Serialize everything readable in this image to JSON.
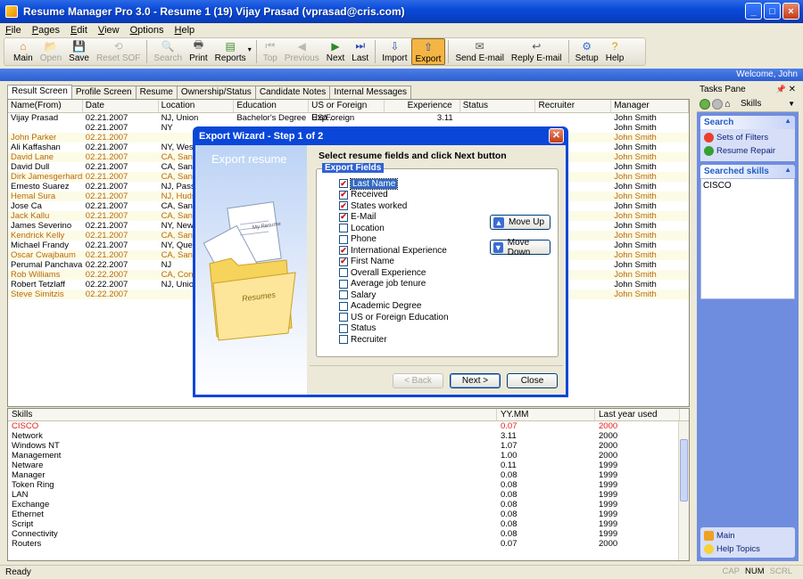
{
  "window": {
    "title": "Resume Manager Pro 3.0 - Resume 1 (19)   Vijay Prasad (vprasad@cris.com)",
    "controls": [
      "_",
      "□",
      "×"
    ]
  },
  "menu": [
    "File",
    "Pages",
    "Edit",
    "View",
    "Options",
    "Help"
  ],
  "toolbar": [
    {
      "label": "Main",
      "icon": "main-icon",
      "state": "normal"
    },
    {
      "label": "Open",
      "icon": "open-icon",
      "state": "disabled"
    },
    {
      "label": "Save",
      "icon": "save-icon",
      "state": "normal"
    },
    {
      "label": "Reset SOF",
      "icon": "reset-icon",
      "state": "disabled"
    },
    {
      "label": "Search",
      "icon": "search-icon",
      "state": "disabled"
    },
    {
      "label": "Print",
      "icon": "print-icon",
      "state": "normal"
    },
    {
      "label": "Reports",
      "icon": "reports-icon",
      "state": "normal"
    },
    {
      "label": "Top",
      "icon": "top-icon",
      "state": "disabled"
    },
    {
      "label": "Previous",
      "icon": "previous-icon",
      "state": "disabled"
    },
    {
      "label": "Next",
      "icon": "next-icon",
      "state": "normal"
    },
    {
      "label": "Last",
      "icon": "last-icon",
      "state": "normal"
    },
    {
      "label": "Import",
      "icon": "import-icon",
      "state": "normal"
    },
    {
      "label": "Export",
      "icon": "export-icon",
      "state": "active"
    },
    {
      "label": "Send E-mail",
      "icon": "send-email-icon",
      "state": "normal"
    },
    {
      "label": "Reply E-mail",
      "icon": "reply-email-icon",
      "state": "normal"
    },
    {
      "label": "Setup",
      "icon": "setup-icon",
      "state": "normal"
    },
    {
      "label": "Help",
      "icon": "help-icon",
      "state": "normal"
    }
  ],
  "welcome": "Welcome, John",
  "tabs": [
    "Result Screen",
    "Profile Screen",
    "Resume",
    "Ownership/Status",
    "Candidate Notes",
    "Internal Messages"
  ],
  "results": {
    "columns": [
      "Name(From)",
      "Date",
      "Location",
      "Education",
      "US or Foreign Exp...",
      "Experience",
      "Status",
      "Recruiter",
      "Manager"
    ],
    "rows": [
      {
        "name": "Vijay Prasad",
        "date": "02.21.2007",
        "location": "NJ, Union",
        "education": "Bachelor's Degree",
        "usf": "US/Foreign",
        "experience": "3.11",
        "manager": "John Smith",
        "orange": false
      },
      {
        "name": "",
        "date": "02.21.2007",
        "location": "NY",
        "education": "",
        "usf": "",
        "experience": "",
        "manager": "John Smith",
        "orange": false
      },
      {
        "name": "John Parker",
        "date": "02.21.2007",
        "location": "",
        "education": "",
        "usf": "",
        "experience": "",
        "manager": "John Smith",
        "orange": true
      },
      {
        "name": "Ali Kaffashan",
        "date": "02.21.2007",
        "location": "NY, West",
        "education": "",
        "usf": "",
        "experience": "",
        "manager": "John Smith",
        "orange": false
      },
      {
        "name": "David Lane",
        "date": "02.21.2007",
        "location": "CA, Sant",
        "education": "",
        "usf": "",
        "experience": "",
        "manager": "John Smith",
        "orange": true
      },
      {
        "name": "David Dull",
        "date": "02.21.2007",
        "location": "CA, San",
        "education": "",
        "usf": "",
        "experience": "",
        "manager": "John Smith",
        "orange": false
      },
      {
        "name": "Dirk Jamesgerhardr...",
        "date": "02.21.2007",
        "location": "CA, Sant",
        "education": "",
        "usf": "",
        "experience": "",
        "manager": "John Smith",
        "orange": true
      },
      {
        "name": "Ernesto Suarez",
        "date": "02.21.2007",
        "location": "NJ, Pass",
        "education": "",
        "usf": "",
        "experience": "",
        "manager": "John Smith",
        "orange": false
      },
      {
        "name": "Hemal Sura",
        "date": "02.21.2007",
        "location": "NJ, Huds",
        "education": "",
        "usf": "",
        "experience": "",
        "manager": "John Smith",
        "orange": true
      },
      {
        "name": "Jose Ca",
        "date": "02.21.2007",
        "location": "CA, Sant",
        "education": "",
        "usf": "",
        "experience": "",
        "manager": "John Smith",
        "orange": false
      },
      {
        "name": "Jack Kallu",
        "date": "02.21.2007",
        "location": "CA, Sant",
        "education": "",
        "usf": "",
        "experience": "",
        "manager": "John Smith",
        "orange": true
      },
      {
        "name": "James Severino",
        "date": "02.21.2007",
        "location": "NY, New",
        "education": "",
        "usf": "",
        "experience": "",
        "manager": "John Smith",
        "orange": false
      },
      {
        "name": "Kendrick Kelly",
        "date": "02.21.2007",
        "location": "CA, San",
        "education": "",
        "usf": "",
        "experience": "",
        "manager": "John Smith",
        "orange": true
      },
      {
        "name": "Michael Frandy",
        "date": "02.21.2007",
        "location": "NY, Quee",
        "education": "",
        "usf": "",
        "experience": "",
        "manager": "John Smith",
        "orange": false
      },
      {
        "name": "Oscar Cwajbaum",
        "date": "02.21.2007",
        "location": "CA, Sant",
        "education": "",
        "usf": "",
        "experience": "",
        "manager": "John Smith",
        "orange": true
      },
      {
        "name": "Perumal Panchava...",
        "date": "02.22.2007",
        "location": "NJ",
        "education": "",
        "usf": "",
        "experience": "",
        "manager": "John Smith",
        "orange": false
      },
      {
        "name": "Rob Williams",
        "date": "02.22.2007",
        "location": "CA, Cont",
        "education": "",
        "usf": "",
        "experience": "",
        "manager": "John Smith",
        "orange": true
      },
      {
        "name": "Robert Tetzlaff",
        "date": "02.22.2007",
        "location": "NJ, Unio",
        "education": "",
        "usf": "",
        "experience": "",
        "manager": "John Smith",
        "orange": false
      },
      {
        "name": "Steve Simitzis",
        "date": "02.22.2007",
        "location": "",
        "education": "",
        "usf": "",
        "experience": "",
        "manager": "John Smith",
        "orange": true
      }
    ]
  },
  "skills": {
    "columns": [
      "Skills",
      "YY.MM",
      "Last year used"
    ],
    "rows": [
      {
        "skill": "CISCO",
        "yymm": "0.07",
        "last": "2000",
        "highlight": true
      },
      {
        "skill": "Network",
        "yymm": "3.11",
        "last": "2000",
        "highlight": false
      },
      {
        "skill": "Windows NT",
        "yymm": "1.07",
        "last": "2000",
        "highlight": false
      },
      {
        "skill": "Management",
        "yymm": "1.00",
        "last": "2000",
        "highlight": false
      },
      {
        "skill": "Netware",
        "yymm": "0.11",
        "last": "1999",
        "highlight": false
      },
      {
        "skill": "Manager",
        "yymm": "0.08",
        "last": "1999",
        "highlight": false
      },
      {
        "skill": "Token Ring",
        "yymm": "0.08",
        "last": "1999",
        "highlight": false
      },
      {
        "skill": "LAN",
        "yymm": "0.08",
        "last": "1999",
        "highlight": false
      },
      {
        "skill": "Exchange",
        "yymm": "0.08",
        "last": "1999",
        "highlight": false
      },
      {
        "skill": "Ethernet",
        "yymm": "0.08",
        "last": "1999",
        "highlight": false
      },
      {
        "skill": "Script",
        "yymm": "0.08",
        "last": "1999",
        "highlight": false
      },
      {
        "skill": "Connectivity",
        "yymm": "0.08",
        "last": "1999",
        "highlight": false
      },
      {
        "skill": "Routers",
        "yymm": "0.07",
        "last": "2000",
        "highlight": false
      }
    ]
  },
  "tasks_pane": {
    "title": "Tasks Pane",
    "nav_selected": "Skills",
    "search_title": "Search",
    "search_links": [
      "Sets of Filters",
      "Resume Repair"
    ],
    "searched_title": "Searched skills",
    "searched_items": [
      "CISCO"
    ],
    "footer_links": [
      "Main",
      "Help Topics"
    ]
  },
  "status": {
    "text": "Ready",
    "indicators": [
      {
        "label": "CAP",
        "on": false
      },
      {
        "label": "NUM",
        "on": true
      },
      {
        "label": "SCRL",
        "on": false
      }
    ]
  },
  "dialog": {
    "title": "Export Wizard - Step 1 of 2",
    "art_title": "Export resume",
    "art_paper": "My Resume",
    "art_folder": "Resumes",
    "heading": "Select resume fields and click Next button",
    "legend": "Export Fields",
    "fields": [
      {
        "label": "Last Name",
        "checked": true,
        "selected": true
      },
      {
        "label": "Received",
        "checked": true,
        "selected": false
      },
      {
        "label": "States worked",
        "checked": true,
        "selected": false
      },
      {
        "label": "E-Mail",
        "checked": true,
        "selected": false
      },
      {
        "label": "Location",
        "checked": false,
        "selected": false
      },
      {
        "label": "Phone",
        "checked": false,
        "selected": false
      },
      {
        "label": "International Experience",
        "checked": true,
        "selected": false
      },
      {
        "label": "First Name",
        "checked": true,
        "selected": false
      },
      {
        "label": "Overall Experience",
        "checked": false,
        "selected": false
      },
      {
        "label": "Average job tenure",
        "checked": false,
        "selected": false
      },
      {
        "label": "Salary",
        "checked": false,
        "selected": false
      },
      {
        "label": "Academic Degree",
        "checked": false,
        "selected": false
      },
      {
        "label": "US or Foreign Education",
        "checked": false,
        "selected": false
      },
      {
        "label": "Status",
        "checked": false,
        "selected": false
      },
      {
        "label": "Recruiter",
        "checked": false,
        "selected": false
      }
    ],
    "move_up": "Move Up",
    "move_down": "Move Down",
    "back": "< Back",
    "next": "Next >",
    "close": "Close"
  }
}
